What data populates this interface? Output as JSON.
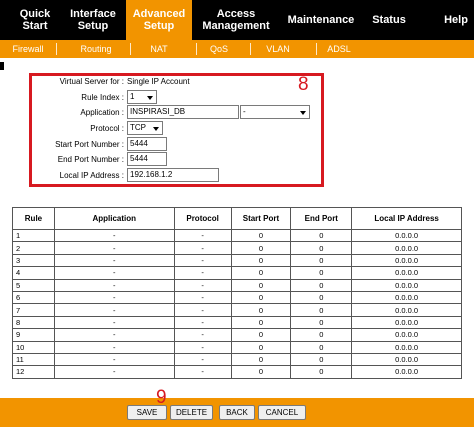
{
  "nav": {
    "items": [
      {
        "line1": "Quick",
        "line2": "Start"
      },
      {
        "line1": "Interface",
        "line2": "Setup"
      },
      {
        "line1": "Advanced",
        "line2": "Setup"
      },
      {
        "line1": "Access",
        "line2": "Management"
      },
      {
        "line1": "Maintenance",
        "line2": ""
      },
      {
        "line1": "Status",
        "line2": ""
      },
      {
        "line1": "Help",
        "line2": ""
      }
    ],
    "active_index": 2,
    "accent_color": "#f29400"
  },
  "subnav": {
    "items": [
      "Firewall",
      "Routing",
      "NAT",
      "QoS",
      "VLAN",
      "ADSL"
    ]
  },
  "form": {
    "virtual_server_label": "Virtual Server for :",
    "virtual_server_value": "Single IP Account",
    "rule_index_label": "Rule Index :",
    "rule_index_value": "1",
    "application_label": "Application :",
    "application_value": "INSPIRASI_DB",
    "application_select_value": "-",
    "protocol_label": "Protocol :",
    "protocol_value": "TCP",
    "start_port_label": "Start Port Number :",
    "start_port_value": "5444",
    "end_port_label": "End Port Number :",
    "end_port_value": "5444",
    "local_ip_label": "Local IP Address :",
    "local_ip_value": "192.168.1.2"
  },
  "annotations": {
    "step_8": "8",
    "step_9": "9",
    "highlight_color": "#d71920"
  },
  "table": {
    "headers": [
      "Rule",
      "Application",
      "Protocol",
      "Start Port",
      "End Port",
      "Local IP Address"
    ],
    "rows": [
      [
        "1",
        "-",
        "-",
        "0",
        "0",
        "0.0.0.0"
      ],
      [
        "2",
        "-",
        "-",
        "0",
        "0",
        "0.0.0.0"
      ],
      [
        "3",
        "-",
        "-",
        "0",
        "0",
        "0.0.0.0"
      ],
      [
        "4",
        "-",
        "-",
        "0",
        "0",
        "0.0.0.0"
      ],
      [
        "5",
        "-",
        "-",
        "0",
        "0",
        "0.0.0.0"
      ],
      [
        "6",
        "-",
        "-",
        "0",
        "0",
        "0.0.0.0"
      ],
      [
        "7",
        "-",
        "-",
        "0",
        "0",
        "0.0.0.0"
      ],
      [
        "8",
        "-",
        "-",
        "0",
        "0",
        "0.0.0.0"
      ],
      [
        "9",
        "-",
        "-",
        "0",
        "0",
        "0.0.0.0"
      ],
      [
        "10",
        "-",
        "-",
        "0",
        "0",
        "0.0.0.0"
      ],
      [
        "11",
        "-",
        "-",
        "0",
        "0",
        "0.0.0.0"
      ],
      [
        "12",
        "-",
        "-",
        "0",
        "0",
        "0.0.0.0"
      ]
    ]
  },
  "buttons": {
    "save": "SAVE",
    "delete": "DELETE",
    "back": "BACK",
    "cancel": "CANCEL"
  }
}
